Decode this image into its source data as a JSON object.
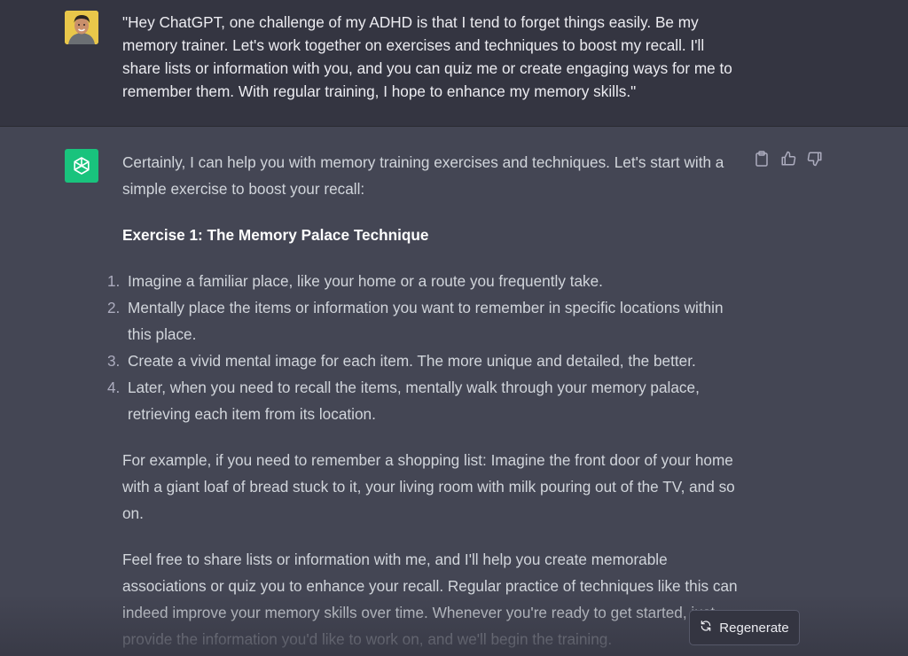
{
  "user_message": {
    "avatar": "user-avatar",
    "text": "\"Hey ChatGPT, one challenge of my ADHD is that I tend to forget things easily. Be my memory trainer. Let's work together on exercises and techniques to boost my recall. I'll share lists or information with you, and you can quiz me or create engaging ways for me to remember them. With regular training, I hope to enhance my memory skills.\""
  },
  "assistant_message": {
    "avatar_icon": "openai-logo-icon",
    "intro": "Certainly, I can help you with memory training exercises and techniques. Let's start with a simple exercise to boost your recall:",
    "heading": "Exercise 1: The Memory Palace Technique",
    "steps": [
      {
        "num": "1.",
        "text": "Imagine a familiar place, like your home or a route you frequently take."
      },
      {
        "num": "2.",
        "text": "Mentally place the items or information you want to remember in specific locations within this place."
      },
      {
        "num": "3.",
        "text": "Create a vivid mental image for each item. The more unique and detailed, the better."
      },
      {
        "num": "4.",
        "text": "Later, when you need to recall the items, mentally walk through your memory palace, retrieving each item from its location."
      }
    ],
    "example": "For example, if you need to remember a shopping list: Imagine the front door of your home with a giant loaf of bread stuck to it, your living room with milk pouring out of the TV, and so on.",
    "closing_main": "Feel free to share lists or information with me, and I'll help you create memorable associations or quiz you to enhance your recall. Regular practice of techniques like this can indeed improve your memory skills over time. Whenever you're ready to get started, just",
    "closing_faded": "provide the information you'd like to work on, and we'll begin the training."
  },
  "actions": {
    "copy_icon": "clipboard-icon",
    "like_icon": "thumbs-up-icon",
    "dislike_icon": "thumbs-down-icon"
  },
  "regenerate": {
    "icon": "refresh-icon",
    "label": "Regenerate"
  },
  "colors": {
    "user_bg": "#343541",
    "assistant_bg": "#444654",
    "bot_avatar": "#19c37d",
    "text": "#d1d5db"
  }
}
